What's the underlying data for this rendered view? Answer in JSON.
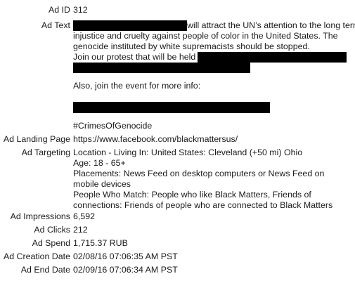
{
  "fields": {
    "ad_id": {
      "label": "Ad ID",
      "value": "312"
    },
    "ad_text": {
      "label": "Ad Text",
      "line1_after_redaction": "will attract the UN’s attention to the long term",
      "line2": "injustice and cruelty against people of color in the United States. The",
      "line3": "genocide instituted by white supremacists should be stopped.",
      "line4_before_redaction": "Join our protest that will be held",
      "line7": "Also, join the event for more info:",
      "hashtag": "#CrimesOfGenocide"
    },
    "landing_page": {
      "label": "Ad Landing Page",
      "value": "https://www.facebook.com/blackmattersus/"
    },
    "targeting": {
      "label": "Ad Targeting",
      "location": "Location - Living In: United States: Cleveland (+50 mi) Ohio",
      "age": "Age: 18 - 65+",
      "placements": "Placements: News Feed on desktop computers or News Feed on mobile devices",
      "people": "People Who Match: People who like Black Matters, Friends of connections: Friends of people who are connected to Black Matters"
    },
    "impressions": {
      "label": "Ad Impressions",
      "value": "6,592"
    },
    "clicks": {
      "label": "Ad Clicks",
      "value": "212"
    },
    "spend": {
      "label": "Ad Spend",
      "value": "1,715.37 RUB"
    },
    "creation_date": {
      "label": "Ad Creation Date",
      "value": "02/08/16 07:06:35 AM PST"
    },
    "end_date": {
      "label": "Ad End Date",
      "value": "02/09/16 07:06:34 AM PST"
    }
  }
}
